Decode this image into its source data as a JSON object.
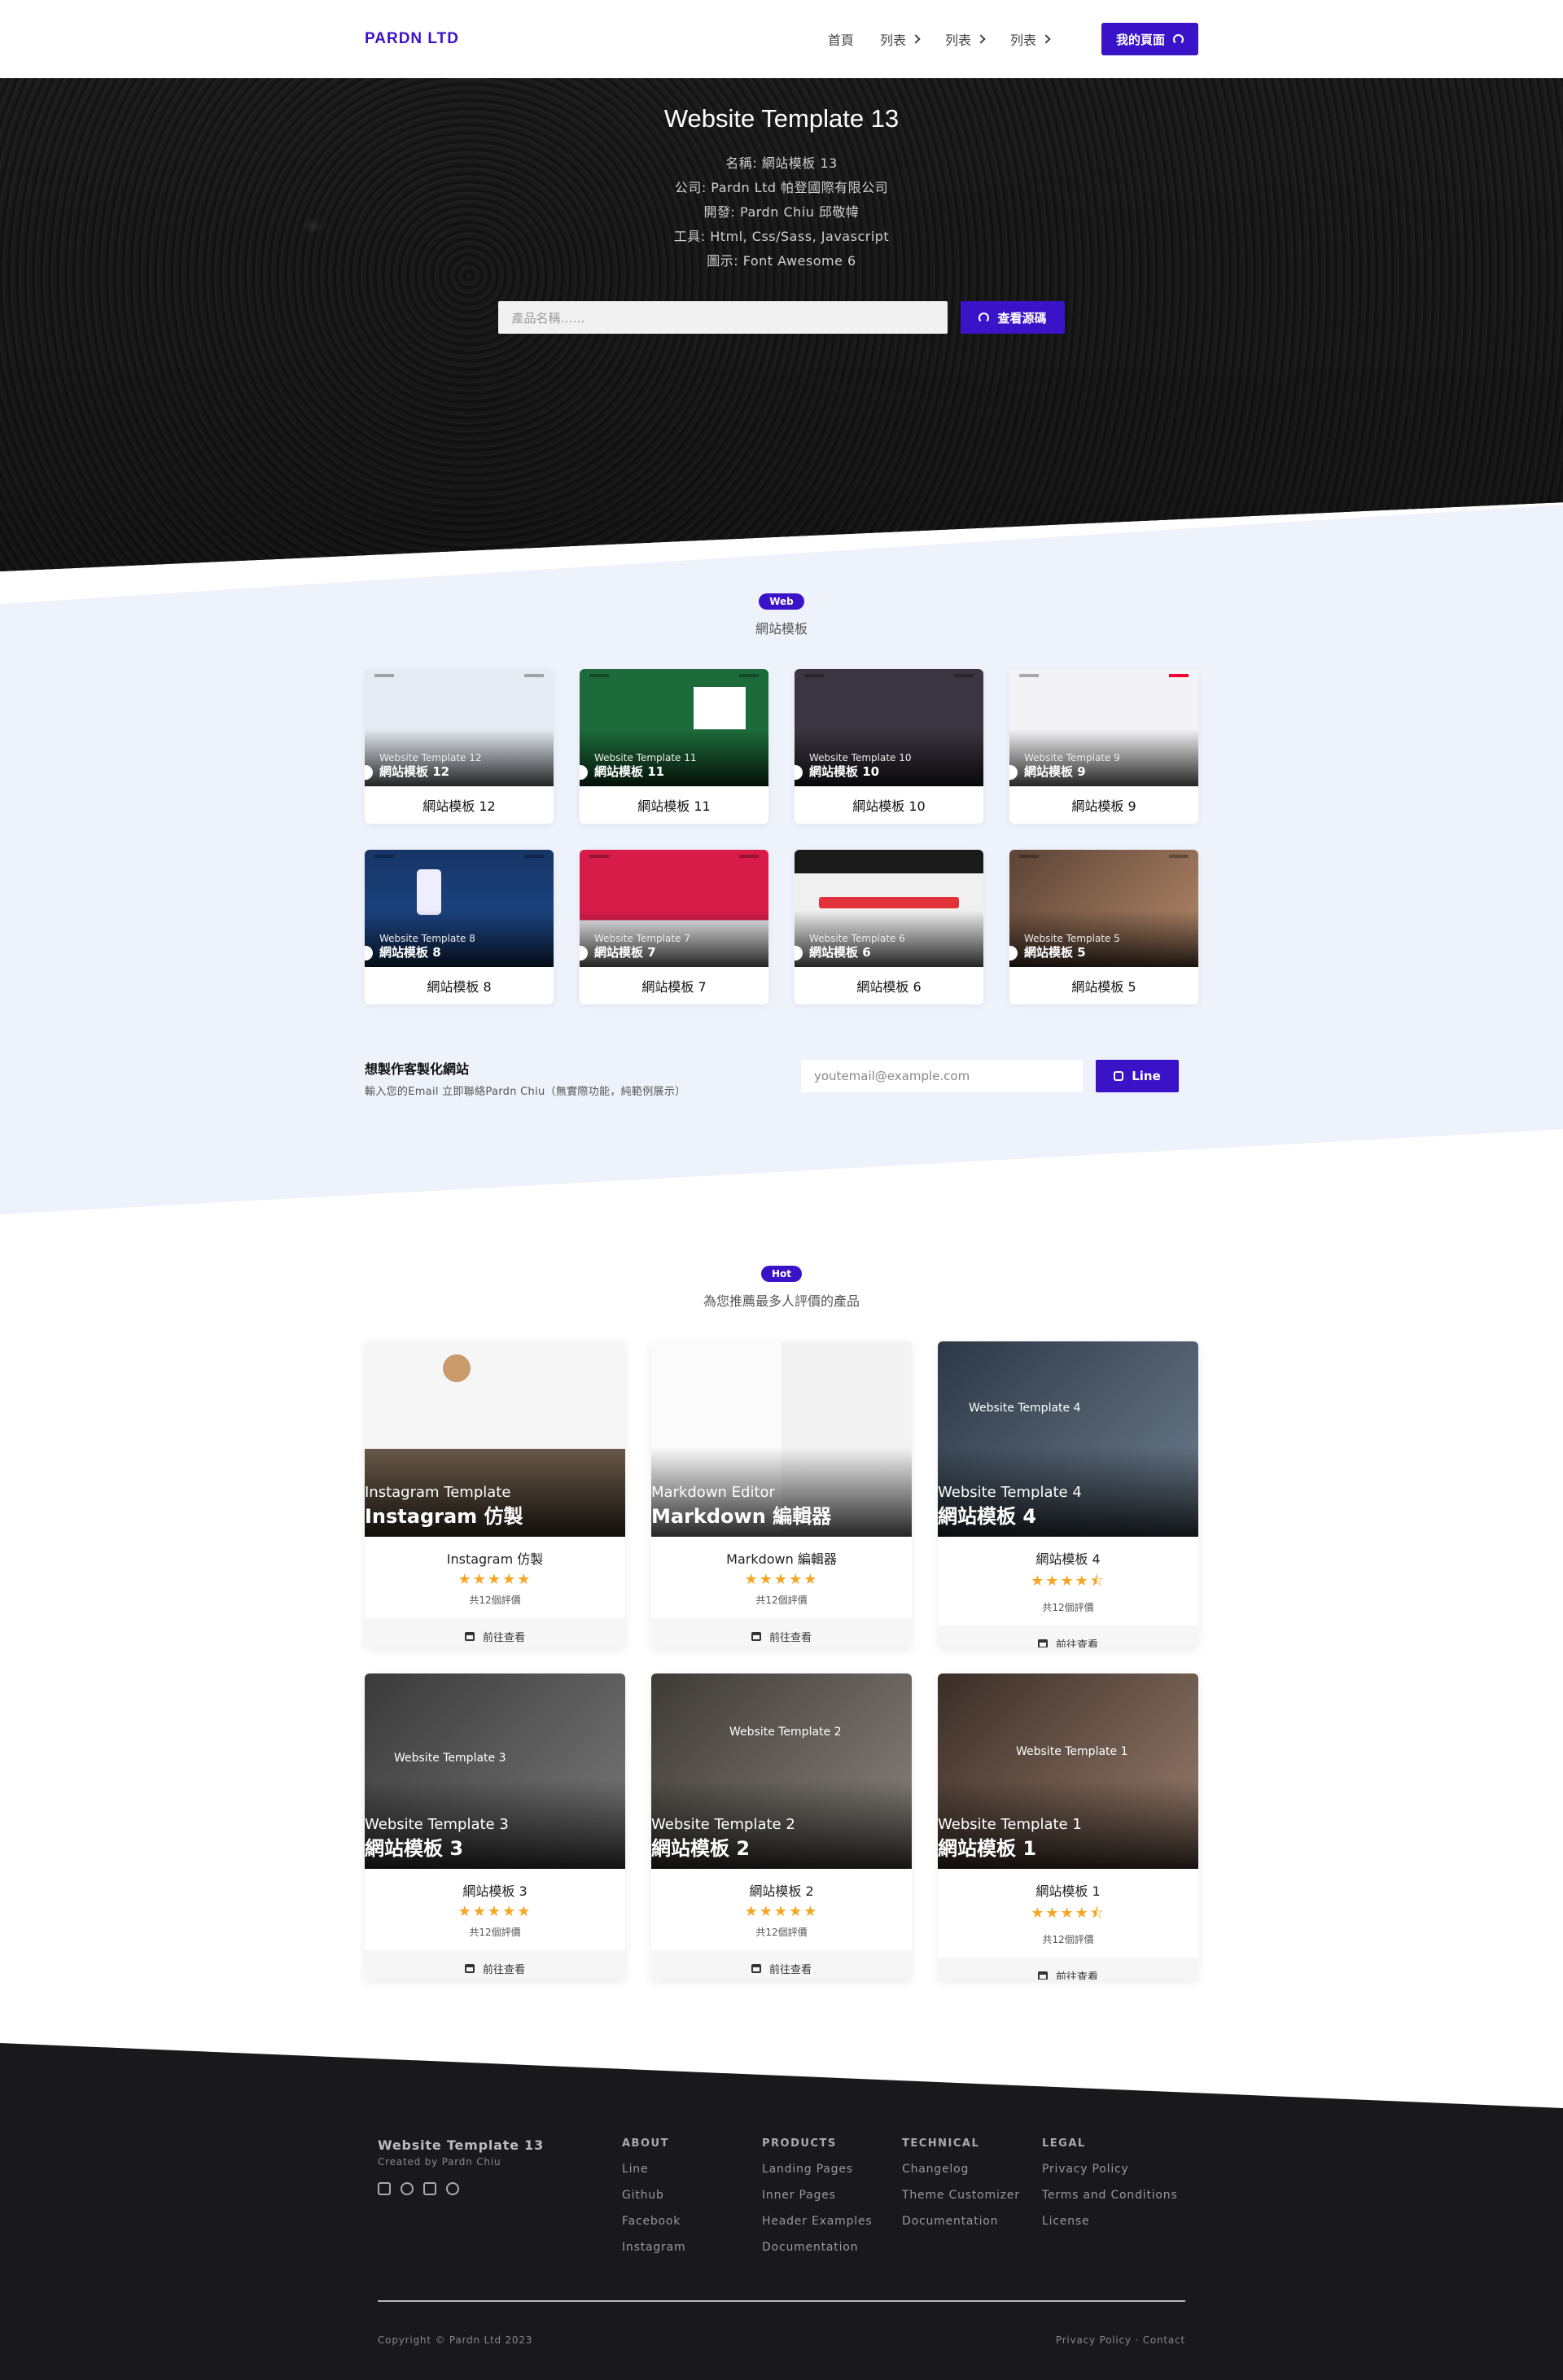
{
  "nav": {
    "brand": "PARDN LTD",
    "items": [
      "首頁",
      "列表",
      "列表",
      "列表"
    ],
    "cta": "我的頁面"
  },
  "hero": {
    "title": "Website Template 13",
    "lines": [
      "名稱: 網站模板 13",
      "公司: Pardn Ltd 帕登國際有限公司",
      "開發: Pardn Chiu 邱敬幃",
      "工具: Html, Css/Sass, Javascript",
      "圖示: Font Awesome 6"
    ],
    "search_placeholder": "產品名稱……",
    "button": "查看源碼"
  },
  "web": {
    "badge": "Web",
    "subtitle": "網站模板",
    "cards": [
      {
        "sub": "Website Template 12",
        "big": "網站模板 12",
        "label": "網站模板 12",
        "color": "#dfe6f2"
      },
      {
        "sub": "Website Template 11",
        "big": "網站模板 11",
        "label": "網站模板 11",
        "color": "#1d6b3b"
      },
      {
        "sub": "Website Template 10",
        "big": "網站模板 10",
        "label": "網站模板 10",
        "color": "#3a3540"
      },
      {
        "sub": "Website Template 9",
        "big": "網站模板 9",
        "label": "網站模板 9",
        "color": "#f3f3f5"
      },
      {
        "sub": "Website Template 8",
        "big": "網站模板 8",
        "label": "網站模板 8",
        "color": "#183a78"
      },
      {
        "sub": "Website Template 7",
        "big": "網站模板 7",
        "label": "網站模板 7",
        "color": "#d81c4a"
      },
      {
        "sub": "Website Template 6",
        "big": "網站模板 6",
        "label": "網站模板 6",
        "color": "#efefef"
      },
      {
        "sub": "Website Template 5",
        "big": "網站模板 5",
        "label": "網站模板 5",
        "color": "#7a5a45"
      }
    ],
    "contact": {
      "title": "想製作客製化網站",
      "desc": "輸入您的Email 立即聯絡Pardn Chiu（無實際功能，純範例展示）",
      "placeholder": "youtemail@example.com",
      "button": "Line"
    }
  },
  "hot": {
    "badge": "Hot",
    "subtitle": "為您推薦最多人評價的產品",
    "cards": [
      {
        "sub": "Instagram Template",
        "big": "Instagram 仿製",
        "name": "Instagram 仿製",
        "stars": "★★★★★",
        "count": "共12個評價",
        "go": "前往查看",
        "color": "#f4f4f4",
        "inner": ""
      },
      {
        "sub": "Markdown Editor",
        "big": "Markdown 編輯器",
        "name": "Markdown 編輯器",
        "stars": "★★★★★",
        "count": "共12個評價",
        "go": "前往查看",
        "color": "#fafafa",
        "inner": ""
      },
      {
        "sub": "Website Template 4",
        "big": "網站模板 4",
        "name": "網站模板 4",
        "stars": "★★★★⯪",
        "count": "共12個評價",
        "go": "前往查看",
        "color": "#3b4a5a",
        "inner": "Website Template 4"
      },
      {
        "sub": "Website Template 3",
        "big": "網站模板 3",
        "name": "網站模板 3",
        "stars": "★★★★★",
        "count": "共12個評價",
        "go": "前往查看",
        "color": "#4a4a4a",
        "inner": "Website Template 3"
      },
      {
        "sub": "Website Template 2",
        "big": "網站模板 2",
        "name": "網站模板 2",
        "stars": "★★★★★",
        "count": "共12個評價",
        "go": "前往查看",
        "color": "#5a5550",
        "inner": "Website Template 2"
      },
      {
        "sub": "Website Template 1",
        "big": "網站模板 1",
        "name": "網站模板 1",
        "stars": "★★★★⯪",
        "count": "共12個評價",
        "go": "前往查看",
        "color": "#4b3d36",
        "inner": "Website Template 1"
      }
    ]
  },
  "footer": {
    "brand": "Website Template 13",
    "created": "Created by Pardn Chiu",
    "columns": [
      {
        "title": "ABOUT",
        "links": [
          "Line",
          "Github",
          "Facebook",
          "Instagram"
        ]
      },
      {
        "title": "PRODUCTS",
        "links": [
          "Landing Pages",
          "Inner Pages",
          "Header Examples",
          "Documentation"
        ]
      },
      {
        "title": "TECHNICAL",
        "links": [
          "Changelog",
          "Theme Customizer",
          "Documentation"
        ]
      },
      {
        "title": "LEGAL",
        "links": [
          "Privacy Policy",
          "Terms and Conditions",
          "License"
        ]
      }
    ],
    "copyright": "Copyright © Pardn Ltd 2023",
    "bottom_links": "Privacy Policy · Contact"
  }
}
